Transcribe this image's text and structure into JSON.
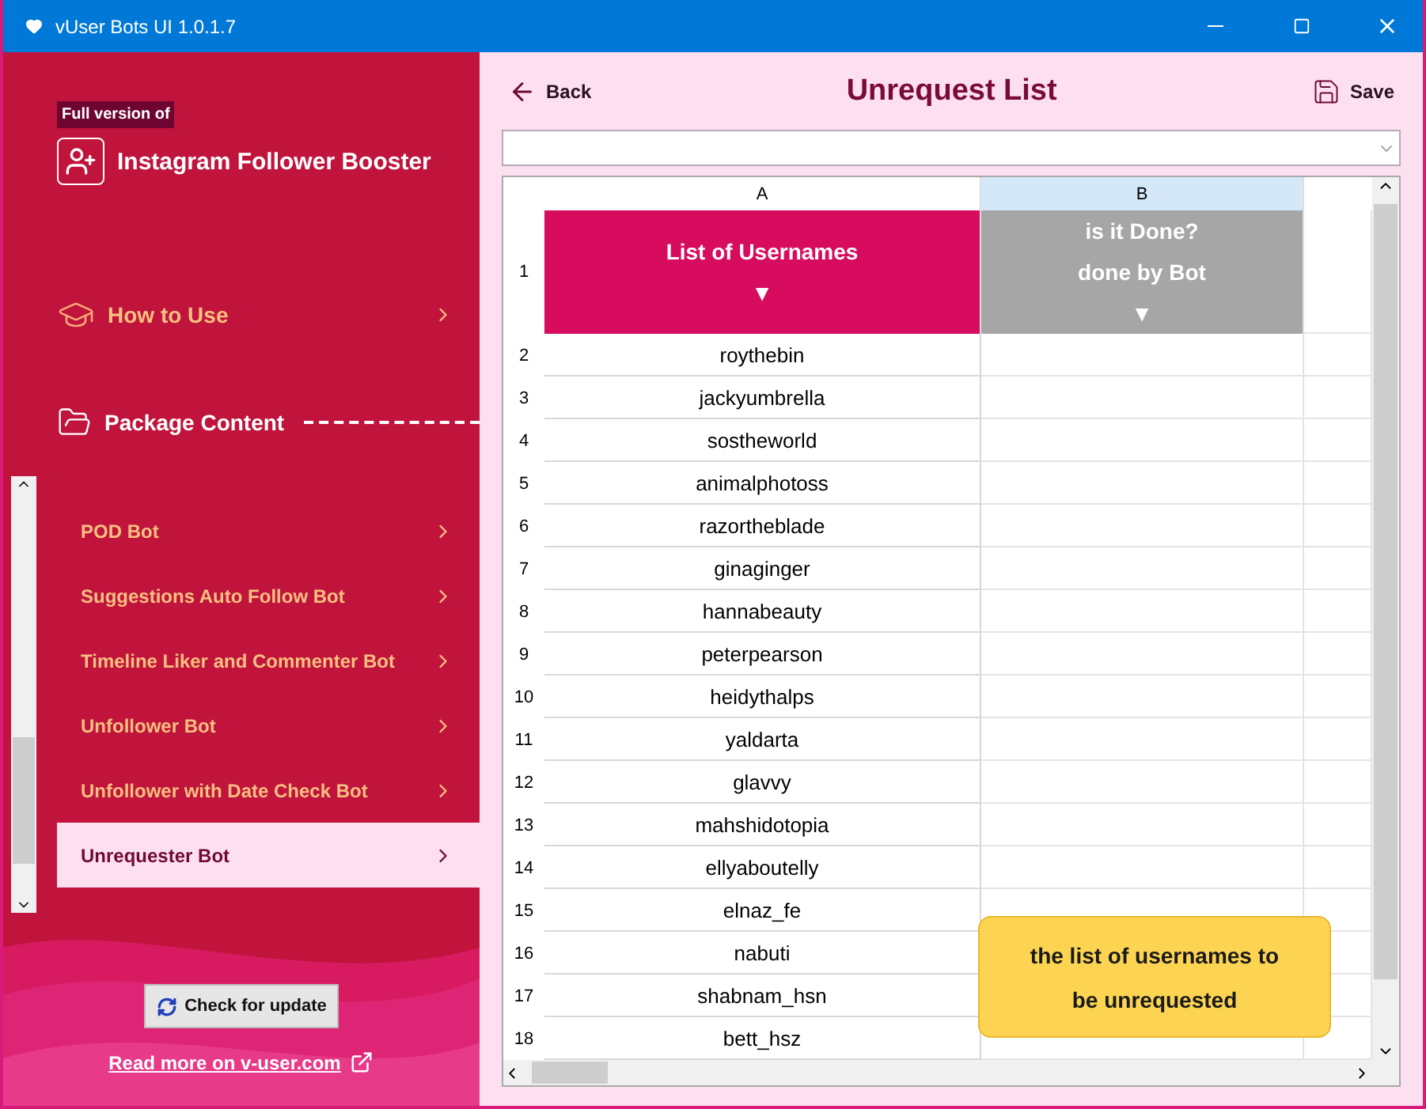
{
  "window": {
    "title": "vUser Bots UI 1.0.1.7"
  },
  "sidebar": {
    "badge": "Full version of",
    "product": "Instagram Follower Booster",
    "sections": [
      {
        "label": "How to Use",
        "kind": "link"
      },
      {
        "label": "Package Content",
        "kind": "header"
      }
    ],
    "items": [
      {
        "label": "POD Bot",
        "selected": false
      },
      {
        "label": "Suggestions Auto Follow Bot",
        "selected": false
      },
      {
        "label": "Timeline Liker and Commenter Bot",
        "selected": false
      },
      {
        "label": "Unfollower Bot",
        "selected": false
      },
      {
        "label": "Unfollower with Date Check Bot",
        "selected": false
      },
      {
        "label": "Unrequester Bot",
        "selected": true
      }
    ],
    "update_button": "Check for update",
    "link": "Read more on v-user.com"
  },
  "header": {
    "back": "Back",
    "title": "Unrequest List",
    "save": "Save"
  },
  "sheet": {
    "columns": [
      {
        "label": "A",
        "selected": false
      },
      {
        "label": "B",
        "selected": true
      }
    ],
    "header_row": "1",
    "header_cells": [
      {
        "lines": [
          "List of Usernames"
        ],
        "marker": "▼",
        "color": "#d80c5f"
      },
      {
        "lines": [
          "is it Done?",
          "done by Bot"
        ],
        "marker": "▼",
        "color": "#a6a6a6"
      }
    ],
    "rows": [
      {
        "number": "2",
        "username": "roythebin"
      },
      {
        "number": "3",
        "username": "jackyumbrella"
      },
      {
        "number": "4",
        "username": "sostheworld"
      },
      {
        "number": "5",
        "username": "animalphotoss"
      },
      {
        "number": "6",
        "username": "razortheblade"
      },
      {
        "number": "7",
        "username": "ginaginger"
      },
      {
        "number": "8",
        "username": "hannabeauty"
      },
      {
        "number": "9",
        "username": "peterpearson"
      },
      {
        "number": "10",
        "username": "heidythalps"
      },
      {
        "number": "11",
        "username": "yaldarta"
      },
      {
        "number": "12",
        "username": "glavvy"
      },
      {
        "number": "13",
        "username": "mahshidotopia"
      },
      {
        "number": "14",
        "username": "ellyaboutelly"
      },
      {
        "number": "15",
        "username": "elnaz_fe"
      },
      {
        "number": "16",
        "username": "nabuti"
      },
      {
        "number": "17",
        "username": "shabnam_hsn"
      },
      {
        "number": "18",
        "username": "bett_hsz"
      }
    ]
  },
  "tooltip": "the list of usernames to be unrequested"
}
